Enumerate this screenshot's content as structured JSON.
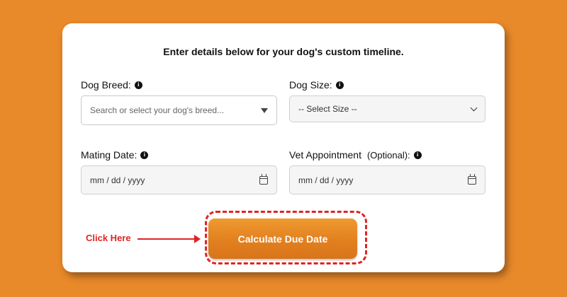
{
  "form": {
    "heading": "Enter details below for your dog's custom timeline.",
    "breed": {
      "label": "Dog Breed:",
      "placeholder": "Search or select your dog's breed..."
    },
    "size": {
      "label": "Dog Size:",
      "selected": "-- Select Size --"
    },
    "mating": {
      "label": "Mating Date:",
      "placeholder": "mm / dd / yyyy"
    },
    "vet": {
      "label": "Vet Appointment",
      "optional": "(Optional):",
      "placeholder": "mm / dd / yyyy"
    },
    "submit_label": "Calculate Due Date"
  },
  "annotation": {
    "text": "Click Here",
    "color": "#e02424"
  },
  "colors": {
    "background": "#e8892a",
    "card": "#ffffff",
    "button": "#e2801f"
  },
  "icons": {
    "info": "info-icon",
    "dropdown": "caret-down-icon",
    "select": "chevron-down-icon",
    "date": "calendar-icon"
  }
}
